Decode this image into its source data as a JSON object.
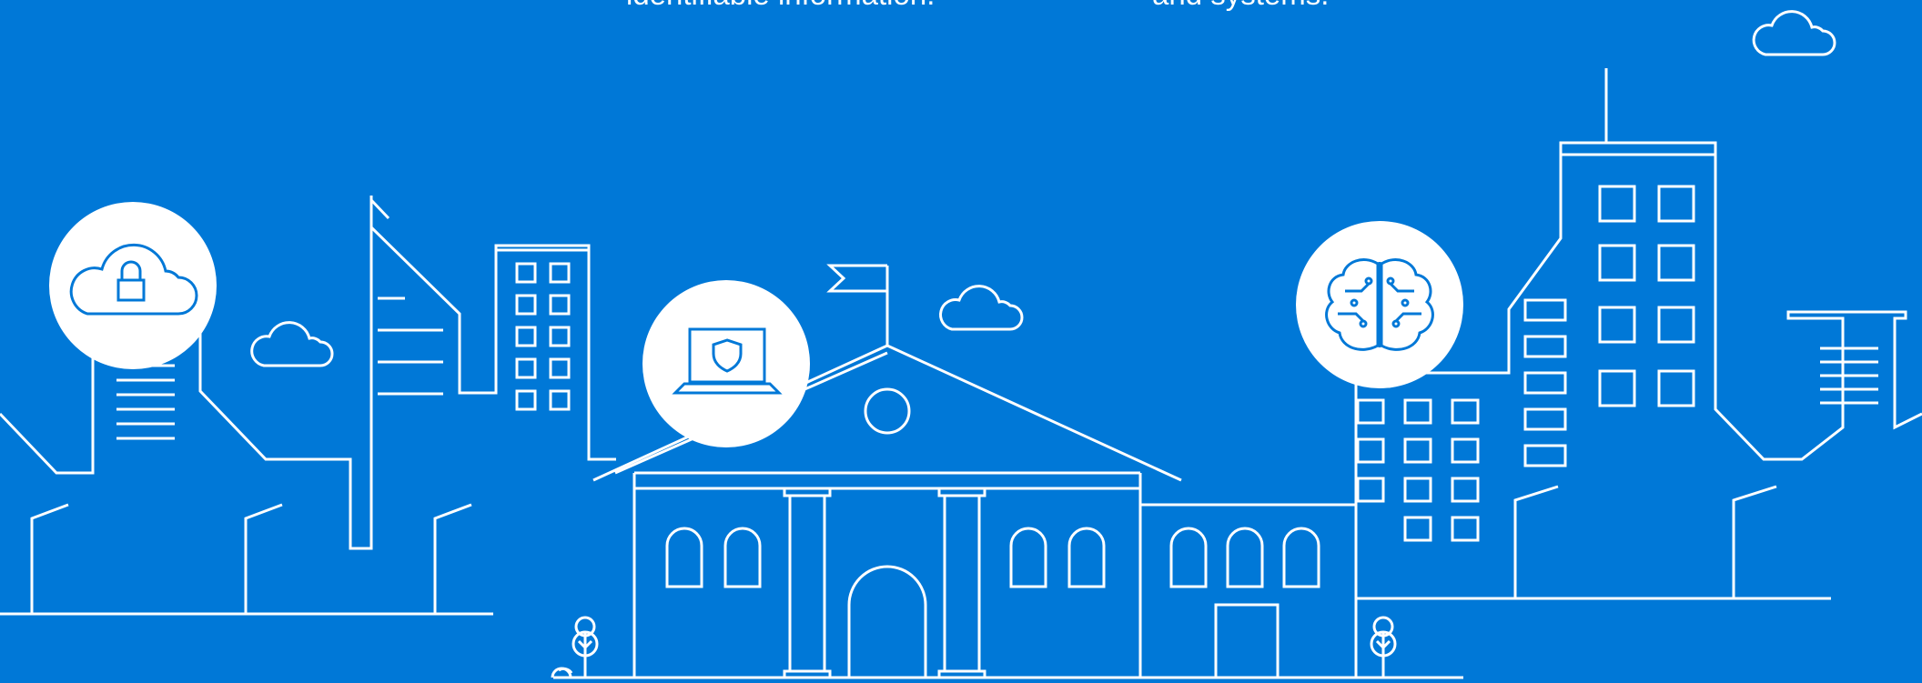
{
  "captions": {
    "left": "identifiable information.",
    "right": "and systems."
  },
  "icons": {
    "cloud_lock": "cloud-lock-icon",
    "laptop_shield": "laptop-shield-icon",
    "ai_brain": "ai-brain-icon",
    "clouds": "cloud-icon",
    "trees": "tree-icon"
  },
  "colors": {
    "background": "#0078D7",
    "line": "#FFFFFF",
    "badge_fill": "#FFFFFF",
    "badge_icon": "#0078D7"
  }
}
